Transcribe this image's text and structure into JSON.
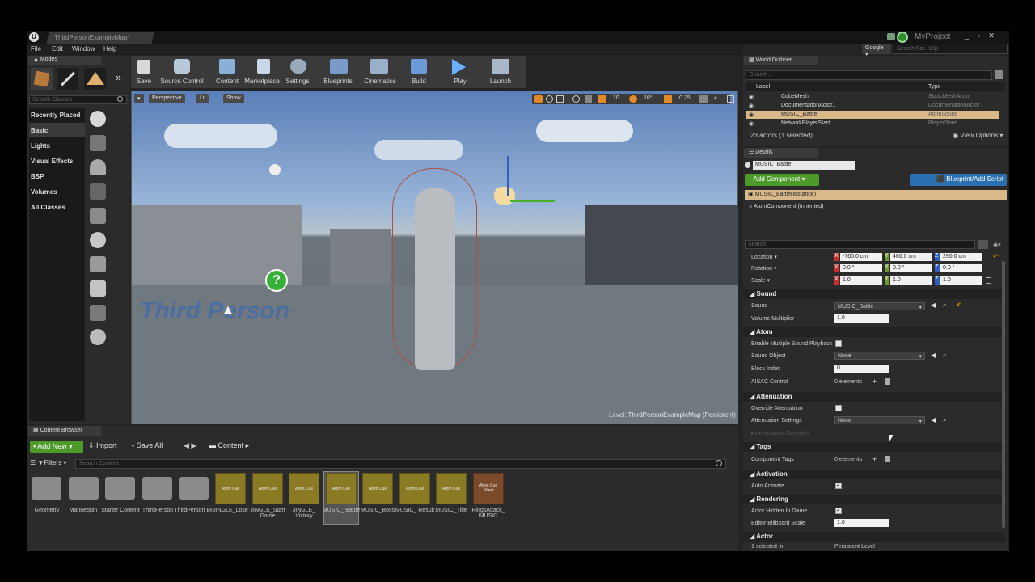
{
  "window": {
    "doc_tab": "ThirdPersonExampleMap*",
    "project": "MyProject",
    "search_dropdown": "Google",
    "search_placeholder": "Search For Help"
  },
  "menu": [
    "File",
    "Edit",
    "Window",
    "Help"
  ],
  "modes": {
    "title": "Modes",
    "search_placeholder": "Search Classes",
    "categories": [
      "Recently Placed",
      "Basic",
      "Lights",
      "Visual Effects",
      "BSP",
      "Volumes",
      "All Classes"
    ]
  },
  "toolbar": [
    "Save",
    "Source Control",
    "Content",
    "Marketplace",
    "Settings",
    "Blueprints",
    "Cinematics",
    "Build",
    "Play",
    "Launch"
  ],
  "viewport": {
    "perspective": "Perspective",
    "lit": "Lit",
    "show": "Show",
    "grid_value": "10",
    "rotation_value": "10°",
    "scale_value": "0.25",
    "camera_speed": "4",
    "level_label": "Level:",
    "level_name": "ThirdPersonExampleMap (Persistent)"
  },
  "outliner": {
    "title": "World Outliner",
    "search_placeholder": "Search...",
    "col_label": "Label",
    "col_type": "Type",
    "rows": [
      {
        "label": "CubeMesh",
        "type": "StaticMeshActor"
      },
      {
        "label": "DocumentationActor1",
        "type": "DocumentationActor"
      },
      {
        "label": "MUSIC_Battle",
        "type": "AtomSound"
      },
      {
        "label": "NetworkPlayerStart",
        "type": "PlayerStart"
      }
    ],
    "count": "23 actors (1 selected)",
    "view_options": "View Options"
  },
  "details": {
    "title": "Details",
    "name_value": "MUSIC_Battle",
    "add_component": "+ Add Component",
    "blueprint": "Blueprint/Add Script",
    "instance": "MUSIC_Battle(Instance)",
    "component": "AtomComponent (Inherited)",
    "search_placeholder": "Search",
    "transform": {
      "location_label": "Location",
      "rotation_label": "Rotation",
      "scale_label": "Scale",
      "location": [
        "-760.0 cm",
        "460.0 cm",
        "290.0 cm"
      ],
      "rotation": [
        "0.0 °",
        "0.0 °",
        "0.0 °"
      ],
      "scale": [
        "1.0",
        "1.0",
        "1.0"
      ],
      "axes": [
        "X",
        "Y",
        "Z"
      ]
    },
    "sections": {
      "sound": "Sound",
      "atom": "Atom",
      "attenuation": "Attenuation",
      "tags": "Tags",
      "activation": "Activation",
      "rendering": "Rendering",
      "actor": "Actor"
    },
    "props": {
      "sound_label": "Sound",
      "sound_value": "MUSIC_Battle",
      "volume_label": "Volume Multiplier",
      "volume_value": "1.0",
      "enable_multi_label": "Enable Multiple Sound Playback",
      "sound_object_label": "Sound Object",
      "sound_object_value": "None",
      "block_index_label": "Block Index",
      "block_index_value": "0",
      "aisac_label": "AISAC Control",
      "aisac_value": "0 elements",
      "override_att_label": "Override Attenuation",
      "att_settings_label": "Attenuation Settings",
      "att_settings_value": "None",
      "att_overrides_label": "Attenuation Overrides",
      "comp_tags_label": "Component Tags",
      "comp_tags_value": "0 elements",
      "auto_activate_label": "Auto Activate",
      "hidden_label": "Actor Hidden In Game",
      "billboard_label": "Editor Billboard Scale",
      "billboard_value": "1.0",
      "selected_label": "1 selected in",
      "selected_value": "Persistent Level"
    }
  },
  "content_browser": {
    "title": "Content Browser",
    "add_new": "Add New",
    "import": "Import",
    "save_all": "Save All",
    "path": "Content",
    "filters": "Filters",
    "search_placeholder": "Search Content",
    "folders": [
      "Geometry",
      "Mannequin",
      "Starter Content",
      "ThirdPerson",
      "ThirdPerson BP"
    ],
    "assets": [
      {
        "cap": "Atom Cue",
        "name": "JINGLE_Lose"
      },
      {
        "cap": "Atom Cue",
        "name": "JINGLE_Start Game"
      },
      {
        "cap": "Atom Cue",
        "name": "JINGLE_ Victory"
      },
      {
        "cap": "Atom Cue",
        "name": "MUSIC_ Battle"
      },
      {
        "cap": "Atom Cue",
        "name": "MUSIC_Boss"
      },
      {
        "cap": "Atom Cue",
        "name": "MUSIC_ Result"
      },
      {
        "cap": "Atom Cue",
        "name": "MUSIC_Title"
      },
      {
        "cap": "Atom Cue Sheet",
        "name": "RingsAttack_ MUSIC"
      }
    ]
  },
  "colors": {
    "accent_green": "#4c9a2a",
    "accent_blue": "#2a6fb0",
    "selection": "#d9b98a",
    "axis_x": "#c62e2e",
    "axis_y": "#6a9a2a",
    "axis_z": "#2f5fbf"
  }
}
